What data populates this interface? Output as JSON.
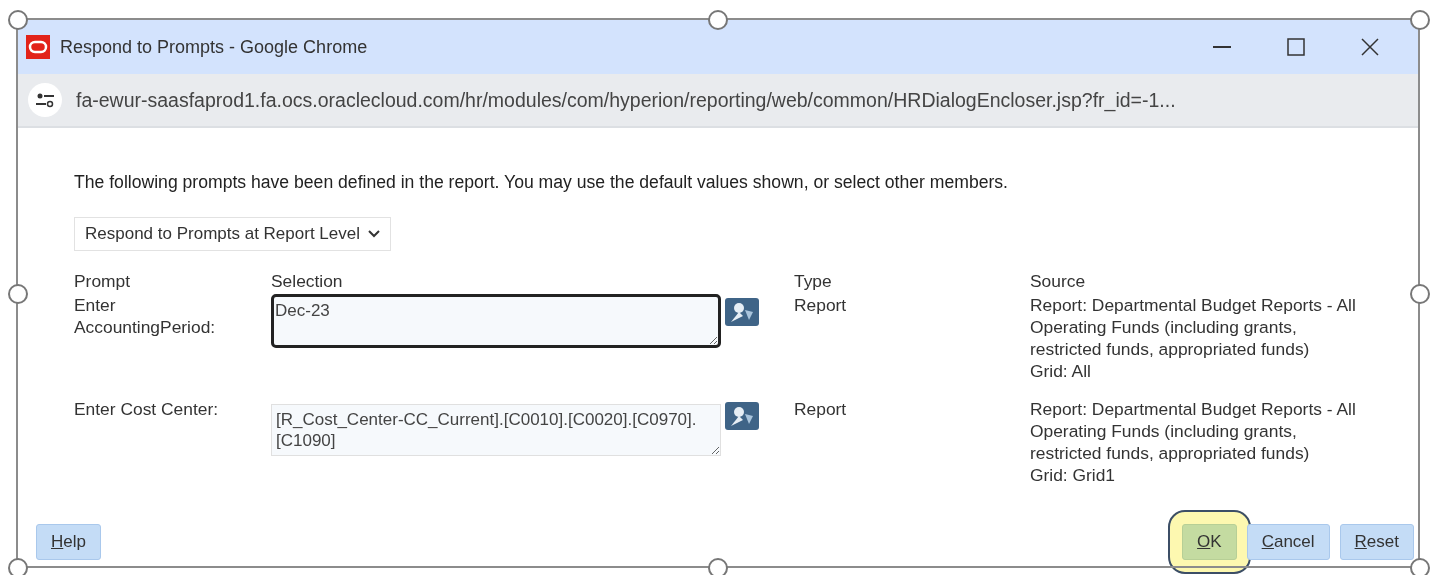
{
  "window": {
    "title": "Respond to Prompts - Google Chrome",
    "url": "fa-ewur-saasfaprod1.fa.ocs.oraclecloud.com/hr/modules/com/hyperion/reporting/web/common/HRDialogEncloser.jsp?fr_id=-1..."
  },
  "intro": "The following prompts have been defined in the report. You may use the default values shown, or select other members.",
  "level_dropdown": {
    "value": "Respond to Prompts at Report Level"
  },
  "columns": [
    "Prompt",
    "Selection",
    "Type",
    "Source"
  ],
  "prompts": [
    {
      "prompt": "Enter AccountingPeriod:",
      "selection": "Dec-23",
      "focused": true,
      "type": "Report",
      "source": "Report: Departmental Budget Reports - All Operating Funds (including grants, restricted funds, appropriated funds)",
      "grid": "Grid: All"
    },
    {
      "prompt": "Enter Cost Center:",
      "selection": "[R_Cost_Center-CC_Current].[C0010].[C0020].[C0970].[C1090]",
      "focused": false,
      "type": "Report",
      "source": "Report: Departmental Budget Reports - All Operating Funds (including grants, restricted funds, appropriated funds)",
      "grid": "Grid: Grid1"
    }
  ],
  "buttons_left": [
    {
      "label": "Help",
      "access_key": true,
      "highlighted": false
    }
  ],
  "buttons_right": [
    {
      "label": "OK",
      "access_key": true,
      "highlighted": true
    },
    {
      "label": "Cancel",
      "access_key": true,
      "highlighted": false
    },
    {
      "label": "Reset",
      "access_key": true,
      "highlighted": false
    }
  ]
}
